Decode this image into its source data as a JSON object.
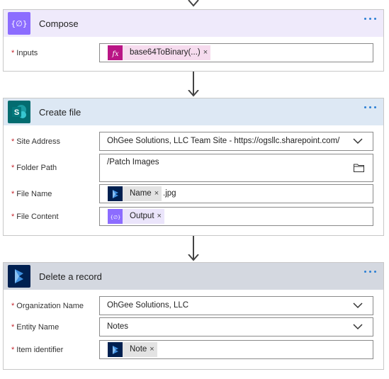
{
  "colors": {
    "compose_header": "#efeafb",
    "compose_icon": "#8c6cff",
    "createfile_header": "#dde8f4",
    "createfile_icon": "#036c70",
    "delete_header": "#d4d8e0",
    "delete_icon": "#002050",
    "fx_token": "#b91585",
    "fx_token_bg": "#f6dbee",
    "link_blue": "#2b7fd4",
    "required": "#c4262e"
  },
  "compose": {
    "title": "Compose",
    "icon": "compose-braces-icon",
    "inputs_label": "Inputs",
    "inputs_token": {
      "label": "base64ToBinary(...)",
      "icon": "fx-icon",
      "close": "×"
    }
  },
  "create_file": {
    "title": "Create file",
    "icon": "sharepoint-icon",
    "site_address_label": "Site Address",
    "site_address_value": "OhGee Solutions, LLC Team Site - https://ogsllc.sharepoint.com/",
    "folder_path_label": "Folder Path",
    "folder_path_value": "/Patch Images",
    "file_name_label": "File Name",
    "file_name_token": {
      "label": "Name",
      "icon": "dynamics-icon",
      "close": "×"
    },
    "file_name_suffix": ".jpg",
    "file_content_label": "File Content",
    "file_content_token": {
      "label": "Output",
      "icon": "compose-braces-icon",
      "close": "×"
    }
  },
  "delete_record": {
    "title": "Delete a record",
    "icon": "dynamics-icon",
    "org_name_label": "Organization Name",
    "org_name_value": "OhGee Solutions, LLC",
    "entity_name_label": "Entity Name",
    "entity_name_value": "Notes",
    "item_id_label": "Item identifier",
    "item_id_token": {
      "label": "Note",
      "icon": "dynamics-icon",
      "close": "×"
    }
  },
  "required_marker": "*"
}
